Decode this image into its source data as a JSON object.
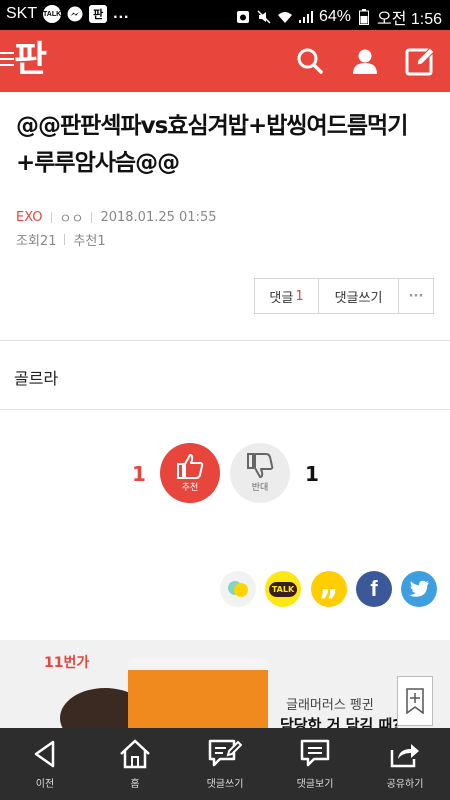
{
  "status_bar": {
    "carrier": "SKT",
    "badge_talk": "TALK",
    "pann_badge": "판",
    "more": "...",
    "battery": "64%",
    "time": "오전 1:56"
  },
  "header": {
    "logo": "판",
    "colors": {
      "brand": "#e8453c"
    }
  },
  "article": {
    "title": "@@판판섹파vs효심겨밥+밥씽여드름먹기+루루암사슴@@",
    "category": "EXO",
    "author": "ㅇㅇ",
    "datetime": "2018.01.25 01:55",
    "views": "조회21",
    "recommend": "추천1",
    "body": "골르라"
  },
  "actions": {
    "comments_label": "댓글",
    "comments_count": "1",
    "write_comment": "댓글쓰기",
    "more": "···"
  },
  "votes": {
    "up_count": "1",
    "up_label": "추천",
    "down_label": "반대",
    "down_count": "1"
  },
  "share": {
    "kakaotalk_label": "TALK",
    "kakaostory_label": "„",
    "facebook_label": "f"
  },
  "ad": {
    "brand": "11번가",
    "line1": "글래머러스 펭귄",
    "line2": "담당한 거 담김 때?"
  },
  "bottom_nav": [
    {
      "label": "이전",
      "icon": "back-icon"
    },
    {
      "label": "홈",
      "icon": "home-icon"
    },
    {
      "label": "댓글쓰기",
      "icon": "write-comment-icon"
    },
    {
      "label": "댓글보기",
      "icon": "view-comments-icon"
    },
    {
      "label": "공유하기",
      "icon": "share-icon"
    }
  ]
}
